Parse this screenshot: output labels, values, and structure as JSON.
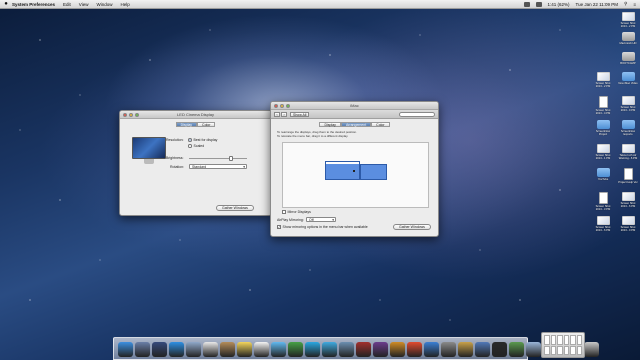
{
  "menubar": {
    "apple": "",
    "app_name": "System Preferences",
    "menus": [
      "Edit",
      "View",
      "Window",
      "Help"
    ],
    "battery": "1:41 (62%)",
    "clock": "Tue Jan 22  11:09 PM"
  },
  "led_window": {
    "title": "LED Cinema Display",
    "tabs": [
      "Display",
      "Color"
    ],
    "active_tab": "Display",
    "resolution_label": "Resolution:",
    "resolution_options": [
      "Best for display",
      "Scaled"
    ],
    "resolution_selected": "Best for display",
    "brightness_label": "Brightness:",
    "brightness_value": 0.72,
    "rotation_label": "Rotation:",
    "rotation_value": "Standard",
    "gather_button": "Gather Windows"
  },
  "imac_window": {
    "title": "iMac",
    "show_all": "Show All",
    "search_placeholder": "",
    "tabs": [
      "Display",
      "Arrangement",
      "Color"
    ],
    "active_tab": "Arrangement",
    "instruction_1": "To rearrange the displays, drag them to the desired position.",
    "instruction_2": "To relocate the menu bar, drag it to a different display.",
    "mirror_label": "Mirror Displays",
    "airplay_label": "AirPlay Mirroring:",
    "airplay_value": "Off",
    "show_options_label": "Show mirroring options in the menu bar when available",
    "gather_button": "Gather Windows"
  },
  "desktop_icons": [
    {
      "label": "Screen Shot 2013...2 PM",
      "type": "shot"
    },
    {
      "label": "Macintosh HD",
      "type": "disk"
    },
    {
      "label": "BOOTCAMP",
      "type": "disk"
    },
    {
      "label": "Screen Shot 2013...2 PM",
      "type": "shot"
    },
    {
      "label": "New iMac Video",
      "type": "folder"
    },
    {
      "label": "Screen Shot 2013...4 PM",
      "type": "doc"
    },
    {
      "label": "Screen Shot 2013...9 PM",
      "type": "shot"
    },
    {
      "label": "ScreenFlow Project",
      "type": "folder"
    },
    {
      "label": "ScreenFlow Exports",
      "type": "folder"
    },
    {
      "label": "Screen Shot 2013...1 PM",
      "type": "shot"
    },
    {
      "label": "Tekno Inch Air Warning...6 PM",
      "type": "shot"
    },
    {
      "label": "YouTube",
      "type": "folder"
    },
    {
      "label": "Project Help Ver",
      "type": "doc"
    },
    {
      "label": "Screen Shot 2013...3 PM",
      "type": "doc"
    },
    {
      "label": "Screen Shot 2013...6 PM",
      "type": "shot"
    },
    {
      "label": "Screen Shot 2013...6 PM",
      "type": "shot"
    },
    {
      "label": "Screen Shot 2013...0 PM",
      "type": "shot"
    }
  ],
  "dock_icons": [
    {
      "name": "finder",
      "color": "#3c8fe0"
    },
    {
      "name": "launchpad",
      "color": "#6a7fa8"
    },
    {
      "name": "mission-control",
      "color": "#364a7c"
    },
    {
      "name": "safari",
      "color": "#2d8fe3"
    },
    {
      "name": "mail",
      "color": "#8fa9c9"
    },
    {
      "name": "calendar",
      "color": "#e9e9e9"
    },
    {
      "name": "contacts",
      "color": "#b48c5a"
    },
    {
      "name": "notes",
      "color": "#f3d55c"
    },
    {
      "name": "reminders",
      "color": "#f4f4f4"
    },
    {
      "name": "messages",
      "color": "#61b9f0"
    },
    {
      "name": "facetime",
      "color": "#46a146"
    },
    {
      "name": "skype",
      "color": "#2aa7e1"
    },
    {
      "name": "itunes",
      "color": "#3faadf"
    },
    {
      "name": "iphoto",
      "color": "#6c8fb0"
    },
    {
      "name": "photo-booth",
      "color": "#a2302d"
    },
    {
      "name": "imovie",
      "color": "#6b3d8c"
    },
    {
      "name": "garageband",
      "color": "#cf8b26"
    },
    {
      "name": "chrome",
      "color": "#e24a2e"
    },
    {
      "name": "app-store",
      "color": "#3b7fd4"
    },
    {
      "name": "system-preferences",
      "color": "#8a8a8a"
    },
    {
      "name": "screenflow",
      "color": "#c8a14a"
    },
    {
      "name": "xcode",
      "color": "#5179b8"
    },
    {
      "name": "terminal",
      "color": "#2a2a2a"
    },
    {
      "name": "activity-monitor",
      "color": "#5a9a4e"
    },
    {
      "name": "preview",
      "color": "#9ab5d8"
    },
    {
      "name": "downloads",
      "color": "#7c9ab9"
    },
    {
      "name": "documents",
      "color": "#8da5c4"
    },
    {
      "name": "trash",
      "color": "#c9c9c9"
    }
  ]
}
